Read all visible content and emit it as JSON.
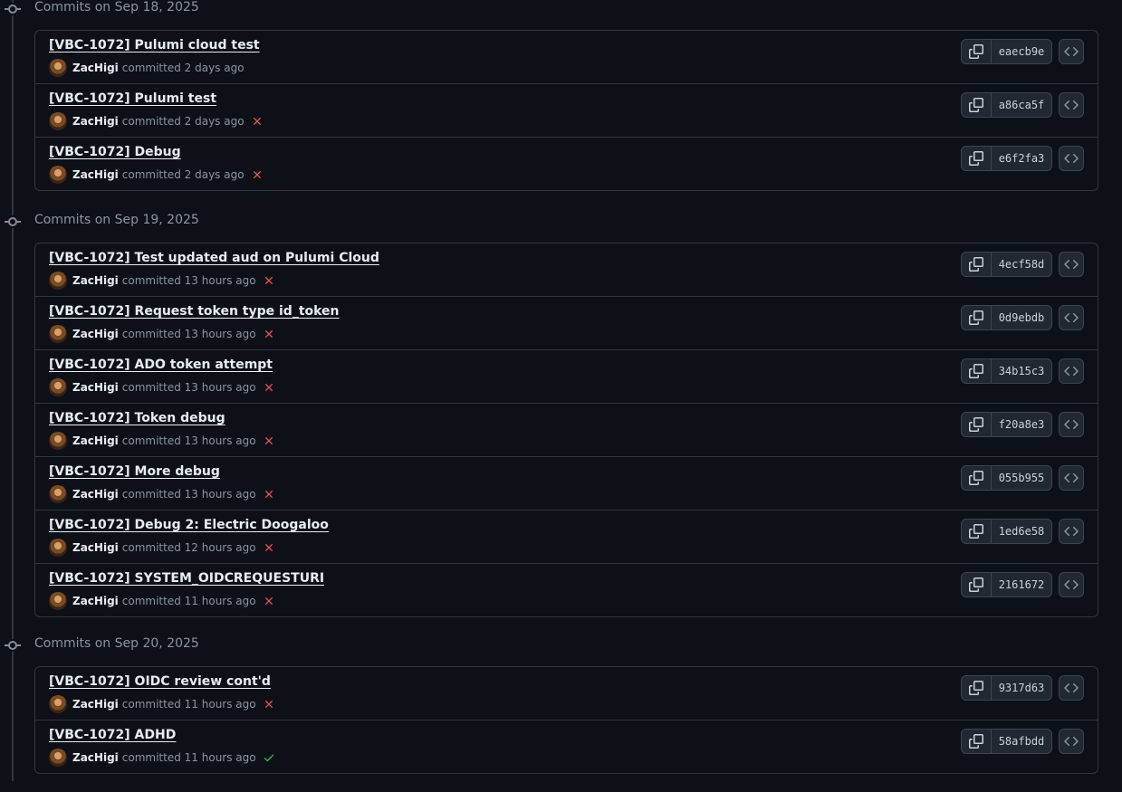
{
  "colors": {
    "background": "#0d1117",
    "border": "#30363d",
    "muted_text": "#8b949e",
    "fail": "#f85149",
    "success": "#3fb950"
  },
  "groups": [
    {
      "title": "Commits on Sep 18, 2025",
      "commits": [
        {
          "title": "[VBC-1072] Pulumi cloud test",
          "author": "ZacHigi",
          "time": "committed 2 days ago",
          "status": "none",
          "sha": "eaecb9e"
        },
        {
          "title": "[VBC-1072] Pulumi test",
          "author": "ZacHigi",
          "time": "committed 2 days ago",
          "status": "fail",
          "sha": "a86ca5f"
        },
        {
          "title": "[VBC-1072] Debug",
          "author": "ZacHigi",
          "time": "committed 2 days ago",
          "status": "fail",
          "sha": "e6f2fa3"
        }
      ]
    },
    {
      "title": "Commits on Sep 19, 2025",
      "commits": [
        {
          "title": "[VBC-1072] Test updated aud on Pulumi Cloud",
          "author": "ZacHigi",
          "time": "committed 13 hours ago",
          "status": "fail",
          "sha": "4ecf58d"
        },
        {
          "title": "[VBC-1072] Request token type id_token",
          "author": "ZacHigi",
          "time": "committed 13 hours ago",
          "status": "fail",
          "sha": "0d9ebdb"
        },
        {
          "title": "[VBC-1072] ADO token attempt",
          "author": "ZacHigi",
          "time": "committed 13 hours ago",
          "status": "fail",
          "sha": "34b15c3"
        },
        {
          "title": "[VBC-1072] Token debug",
          "author": "ZacHigi",
          "time": "committed 13 hours ago",
          "status": "fail",
          "sha": "f20a8e3"
        },
        {
          "title": "[VBC-1072] More debug",
          "author": "ZacHigi",
          "time": "committed 13 hours ago",
          "status": "fail",
          "sha": "055b955"
        },
        {
          "title": "[VBC-1072] Debug 2: Electric Doogaloo",
          "author": "ZacHigi",
          "time": "committed 12 hours ago",
          "status": "fail",
          "sha": "1ed6e58"
        },
        {
          "title": "[VBC-1072] SYSTEM_OIDCREQUESTURI",
          "author": "ZacHigi",
          "time": "committed 11 hours ago",
          "status": "fail",
          "sha": "2161672"
        }
      ]
    },
    {
      "title": "Commits on Sep 20, 2025",
      "commits": [
        {
          "title": "[VBC-1072] OIDC review cont'd",
          "author": "ZacHigi",
          "time": "committed 11 hours ago",
          "status": "fail",
          "sha": "9317d63"
        },
        {
          "title": "[VBC-1072] ADHD",
          "author": "ZacHigi",
          "time": "committed 11 hours ago",
          "status": "success",
          "sha": "58afbdd"
        }
      ]
    }
  ]
}
